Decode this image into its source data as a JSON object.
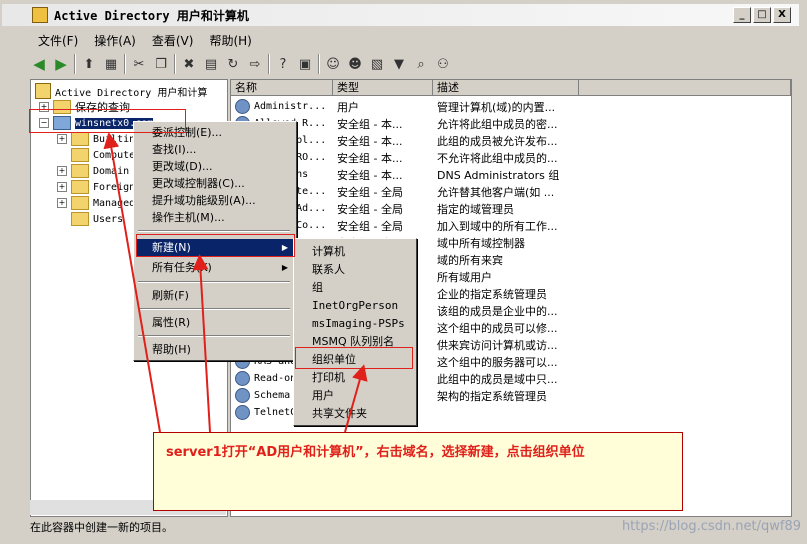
{
  "window": {
    "title": "Active Directory 用户和计算机",
    "controls": [
      "_",
      "□",
      "X"
    ]
  },
  "menubar": [
    "文件(F)",
    "操作(A)",
    "查看(V)",
    "帮助(H)"
  ],
  "tree": {
    "root": "Active Directory 用户和计算",
    "saved_queries": "保存的查询",
    "domain": "winsnetx0.com",
    "children": [
      "Builtin",
      "Computers",
      "Domain",
      "Foreign",
      "Managed",
      "Users"
    ]
  },
  "columns": [
    "名称",
    "类型",
    "描述"
  ],
  "rows": [
    {
      "name": "Administr...",
      "type": "用户",
      "desc": "管理计算机(域)的内置..."
    },
    {
      "name": "Allowed R...",
      "type": "安全组 - 本...",
      "desc": "允许将此组中成员的密..."
    },
    {
      "name": "Cert Publ...",
      "type": "安全组 - 本...",
      "desc": "此组的成员被允许发布..."
    },
    {
      "name": "Denied RO...",
      "type": "安全组 - 本...",
      "desc": "不允许将此组中成员的..."
    },
    {
      "name": "DnsAdmins",
      "type": "安全组 - 本...",
      "desc": "DNS Administrators 组"
    },
    {
      "name": "DnsUpdate...",
      "type": "安全组 - 全局",
      "desc": "允许替其他客户端(如 ..."
    },
    {
      "name": "Domain Ad...",
      "type": "安全组 - 全局",
      "desc": "指定的域管理员"
    },
    {
      "name": "Domain Co...",
      "type": "安全组 - 全局",
      "desc": "加入到域中的所有工作..."
    },
    {
      "name": "Domain Co...",
      "type": "安全组 - 全局",
      "desc": "域中所有域控制器"
    },
    {
      "name": "",
      "type": "",
      "desc": "域的所有来宾"
    },
    {
      "name": "",
      "type": "",
      "desc": "所有域用户"
    },
    {
      "name": "",
      "type": "",
      "desc": "企业的指定系统管理员"
    },
    {
      "name": "",
      "type": "",
      "desc": "该组的成员是企业中的..."
    },
    {
      "name": "",
      "type": "",
      "desc": "这个组中的成员可以修..."
    },
    {
      "name": "",
      "type": "",
      "desc": "供来宾访问计算机或访..."
    },
    {
      "name": "RAS and IA...",
      "type": "",
      "desc": "这个组中的服务器可以..."
    },
    {
      "name": "Read-only...",
      "type": "",
      "desc": "此组中的成员是域中只..."
    },
    {
      "name": "Schema Ad...",
      "type": "",
      "desc": "架构的指定系统管理员"
    },
    {
      "name": "TelnetClients",
      "type": "",
      "desc": ""
    }
  ],
  "context_menu": [
    "委派控制(E)...",
    "查找(I)...",
    "更改域(D)...",
    "更改域控制器(C)...",
    "提升域功能级别(A)...",
    "操作主机(M)...",
    "新建(N)",
    "所有任务(K)",
    "刷新(F)",
    "属性(R)",
    "帮助(H)"
  ],
  "submenu": [
    "计算机",
    "联系人",
    "组",
    "InetOrgPerson",
    "msImaging-PSPs",
    "MSMQ 队列别名",
    "组织单位",
    "打印机",
    "用户",
    "共享文件夹"
  ],
  "annotation": "server1打开“AD用户和计算机”，右击域名，选择新建，点击组织单位",
  "statusbar": "在此容器中创建一新的项目。",
  "watermark": "https://blog.csdn.net/qwf89",
  "colors": {
    "highlight": "#0a246a",
    "annotation_red": "#e0201a",
    "note_bg": "#fffed8"
  }
}
